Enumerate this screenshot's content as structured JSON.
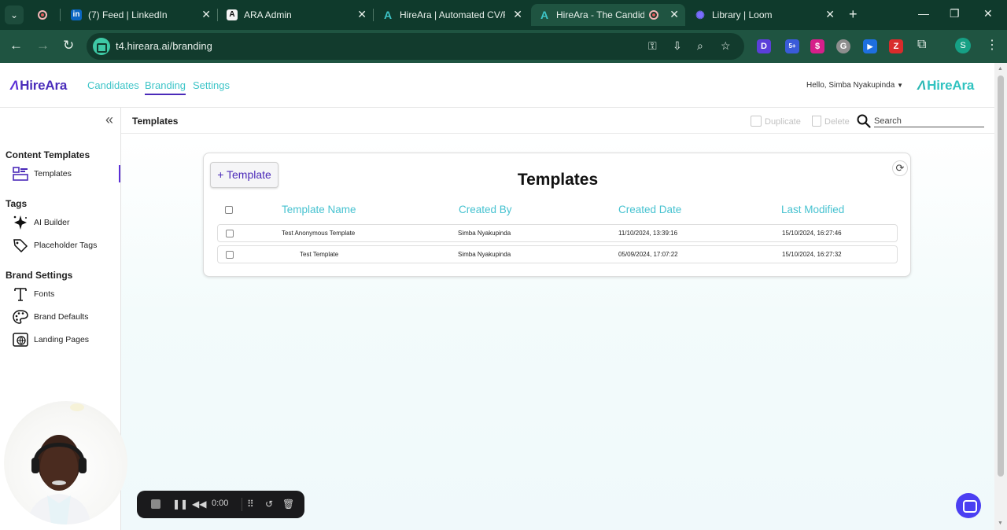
{
  "browser": {
    "tabs": [
      {
        "title": "",
        "favicon": "record-dot"
      },
      {
        "title": "(7) Feed | LinkedIn",
        "favicon": "in"
      },
      {
        "title": "ARA Admin",
        "favicon": "A"
      },
      {
        "title": "HireAra | Automated CV/R",
        "favicon": "A"
      },
      {
        "title": "HireAra - The Candidat",
        "favicon": "A",
        "active": true
      },
      {
        "title": "Library | Loom",
        "favicon": "loom"
      }
    ],
    "url": "t4.hireara.ai/branding",
    "extensions": [
      "D",
      "5+",
      "$",
      "G",
      "▶",
      "Z"
    ],
    "profile_initial": "S"
  },
  "app": {
    "logo": "HireAra",
    "nav": [
      "Candidates",
      "Branding",
      "Settings"
    ],
    "active_nav": "Branding",
    "greeting": "Hello, Simba Nyakupinda",
    "brand_logo": "HireAra"
  },
  "sidebar": {
    "sections": [
      {
        "heading": "Content Templates",
        "items": [
          {
            "label": "Templates",
            "icon": "templates-icon",
            "active": true
          }
        ]
      },
      {
        "heading": "Tags",
        "items": [
          {
            "label": "AI Builder",
            "icon": "ai-builder-icon"
          },
          {
            "label": "Placeholder Tags",
            "icon": "placeholder-tags-icon"
          }
        ]
      },
      {
        "heading": "Brand Settings",
        "items": [
          {
            "label": "Fonts",
            "icon": "fonts-icon"
          },
          {
            "label": "Brand Defaults",
            "icon": "palette-icon"
          },
          {
            "label": "Landing Pages",
            "icon": "globe-icon"
          }
        ]
      }
    ]
  },
  "subbar": {
    "title": "Templates",
    "duplicate": "Duplicate",
    "delete": "Delete",
    "search_placeholder": "Search"
  },
  "templates": {
    "add_button": "+ Template",
    "title": "Templates",
    "columns": [
      "Template Name",
      "Created By",
      "Created Date",
      "Last Modified"
    ],
    "rows": [
      {
        "name": "Test Anonymous Template",
        "created_by": "Simba Nyakupinda",
        "created": "11/10/2024, 13:39:16",
        "modified": "15/10/2024, 16:27:46"
      },
      {
        "name": "Test Template",
        "created_by": "Simba Nyakupinda",
        "created": "05/09/2024, 17:07:22",
        "modified": "15/10/2024, 16:27:32"
      }
    ]
  },
  "recorder": {
    "time": "0:00"
  },
  "colors": {
    "chrome_dark": "#0f3a2c",
    "chrome_toolbar": "#1f5441",
    "brand_purple": "#4b2ab9",
    "brand_teal": "#3ec5c8"
  }
}
